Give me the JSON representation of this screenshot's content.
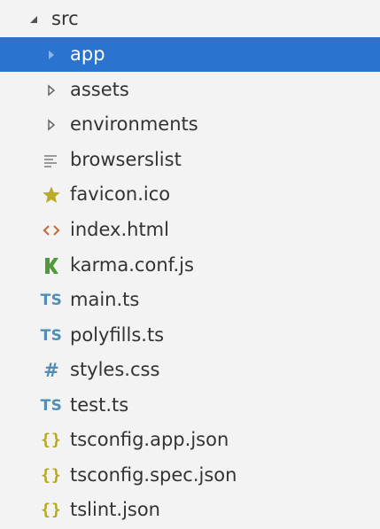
{
  "explorer": {
    "root": {
      "label": "src",
      "expanded": true,
      "icon": "chevron-expanded-icon"
    },
    "items": [
      {
        "label": "app",
        "type": "folder",
        "icon": "chevron-right-icon",
        "selected": true
      },
      {
        "label": "assets",
        "type": "folder",
        "icon": "chevron-right-icon",
        "selected": false
      },
      {
        "label": "environments",
        "type": "folder",
        "icon": "chevron-right-icon",
        "selected": false
      },
      {
        "label": "browserslist",
        "type": "file",
        "icon": "text-lines-icon",
        "selected": false
      },
      {
        "label": "favicon.ico",
        "type": "file",
        "icon": "star-icon",
        "selected": false
      },
      {
        "label": "index.html",
        "type": "file",
        "icon": "html-code-icon",
        "selected": false
      },
      {
        "label": "karma.conf.js",
        "type": "file",
        "icon": "karma-icon",
        "selected": false
      },
      {
        "label": "main.ts",
        "type": "file",
        "icon": "typescript-icon",
        "glyph": "TS",
        "selected": false
      },
      {
        "label": "polyfills.ts",
        "type": "file",
        "icon": "typescript-icon",
        "glyph": "TS",
        "selected": false
      },
      {
        "label": "styles.css",
        "type": "file",
        "icon": "css-hash-icon",
        "glyph": "#",
        "selected": false
      },
      {
        "label": "test.ts",
        "type": "file",
        "icon": "typescript-icon",
        "glyph": "TS",
        "selected": false
      },
      {
        "label": "tsconfig.app.json",
        "type": "file",
        "icon": "json-braces-icon",
        "glyph": "{}",
        "selected": false
      },
      {
        "label": "tsconfig.spec.json",
        "type": "file",
        "icon": "json-braces-icon",
        "glyph": "{}",
        "selected": false
      },
      {
        "label": "tslint.json",
        "type": "file",
        "icon": "json-braces-icon",
        "glyph": "{}",
        "selected": false
      }
    ]
  },
  "colors": {
    "background": "#f3f3f3",
    "selection": "#2a73cf",
    "text": "#333333",
    "selected_text": "#ffffff",
    "typescript": "#4f8eb6",
    "json": "#b3a620",
    "favicon_star": "#b8ac28",
    "html": "#c2703d",
    "karma": "#4e9a3a",
    "chevron": "#777777"
  }
}
